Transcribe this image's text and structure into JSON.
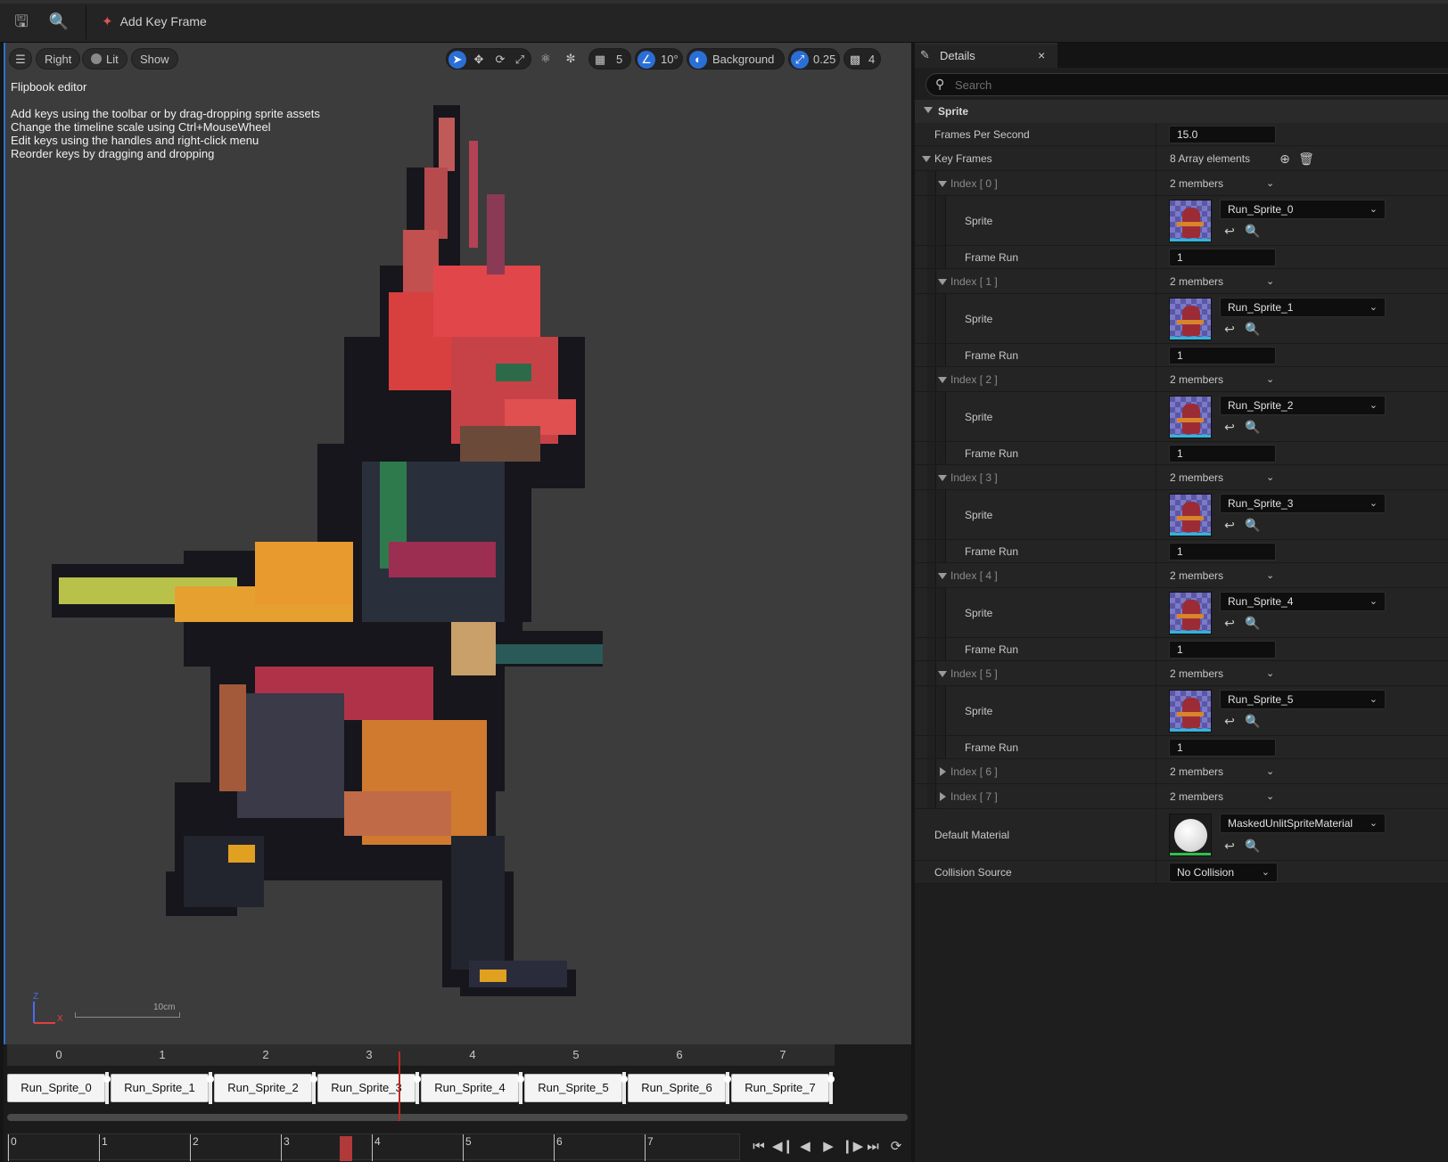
{
  "toolbar": {
    "add_key_frame": "Add Key Frame"
  },
  "viewport": {
    "view_mode": "Right",
    "lighting": "Lit",
    "show": "Show",
    "grid_size": "5",
    "rotation_snap": "10°",
    "background": "Background",
    "scale_snap": "0.25",
    "camera_speed": "4",
    "info_title": "Flipbook editor",
    "info_lines": [
      "Add keys using the toolbar or by drag-dropping sprite assets",
      "Change the timeline scale using Ctrl+MouseWheel",
      "Edit keys using the handles and right-click menu",
      "Reorder keys by dragging and dropping"
    ],
    "scale_label": "10cm",
    "axis_z": "Z",
    "axis_x": "X"
  },
  "timeline": {
    "numbers": [
      "0",
      "1",
      "2",
      "3",
      "4",
      "5",
      "6",
      "7"
    ],
    "frames": [
      "Run_Sprite_0",
      "Run_Sprite_1",
      "Run_Sprite_2",
      "Run_Sprite_3",
      "Run_Sprite_4",
      "Run_Sprite_5",
      "Run_Sprite_6",
      "Run_Sprite_7"
    ],
    "ruler": [
      "0",
      "1",
      "2",
      "3",
      "4",
      "5",
      "6",
      "7"
    ]
  },
  "details": {
    "tab_label": "Details",
    "close": "×",
    "search_placeholder": "Search",
    "section": "Sprite",
    "fps_label": "Frames Per Second",
    "fps_value": "15.0",
    "key_frames_label": "Key Frames",
    "key_frames_value": "8 Array elements",
    "indices": [
      {
        "label": "Index [ 0 ]",
        "members": "2 members",
        "sprite_label": "Sprite",
        "sprite": "Run_Sprite_0",
        "frame_run_label": "Frame Run",
        "frame_run": "1"
      },
      {
        "label": "Index [ 1 ]",
        "members": "2 members",
        "sprite_label": "Sprite",
        "sprite": "Run_Sprite_1",
        "frame_run_label": "Frame Run",
        "frame_run": "1"
      },
      {
        "label": "Index [ 2 ]",
        "members": "2 members",
        "sprite_label": "Sprite",
        "sprite": "Run_Sprite_2",
        "frame_run_label": "Frame Run",
        "frame_run": "1"
      },
      {
        "label": "Index [ 3 ]",
        "members": "2 members",
        "sprite_label": "Sprite",
        "sprite": "Run_Sprite_3",
        "frame_run_label": "Frame Run",
        "frame_run": "1"
      },
      {
        "label": "Index [ 4 ]",
        "members": "2 members",
        "sprite_label": "Sprite",
        "sprite": "Run_Sprite_4",
        "frame_run_label": "Frame Run",
        "frame_run": "1"
      },
      {
        "label": "Index [ 5 ]",
        "members": "2 members",
        "sprite_label": "Sprite",
        "sprite": "Run_Sprite_5",
        "frame_run_label": "Frame Run",
        "frame_run": "1"
      }
    ],
    "collapsed_indices": [
      {
        "label": "Index [ 6 ]",
        "members": "2 members"
      },
      {
        "label": "Index [ 7 ]",
        "members": "2 members"
      }
    ],
    "default_material_label": "Default Material",
    "default_material_value": "MaskedUnlitSpriteMaterial",
    "collision_label": "Collision Source",
    "collision_value": "No Collision"
  },
  "colors": {
    "accent": "#2a6fd6",
    "playhead": "#c02828",
    "thumb_underline": "#2fb7d8",
    "material_underline": "#2fc04a"
  }
}
